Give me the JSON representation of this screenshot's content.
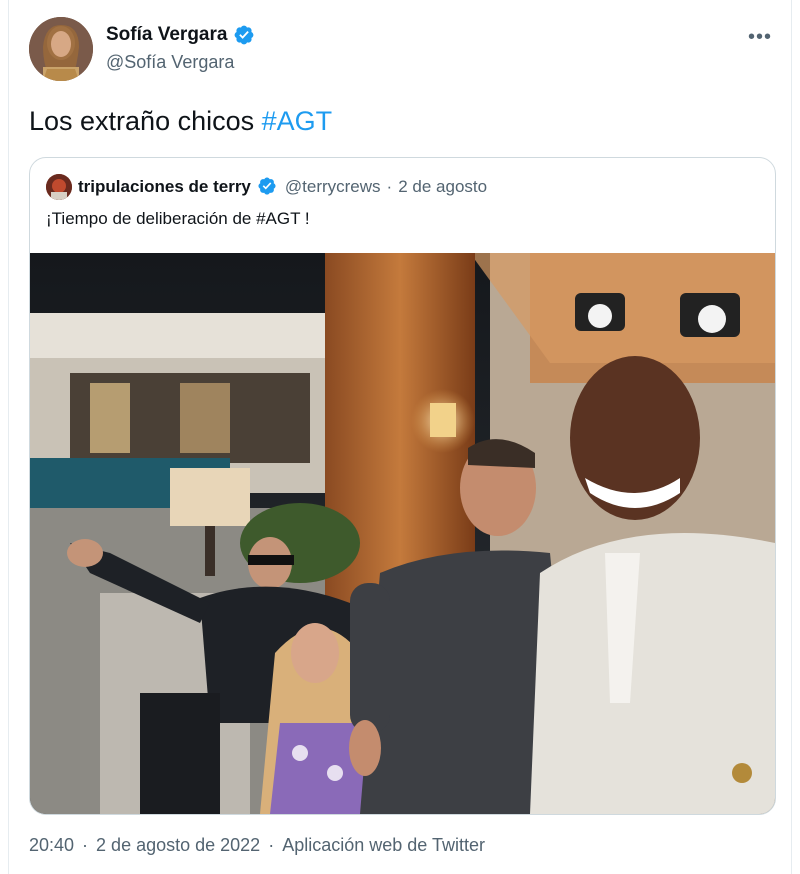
{
  "author": {
    "name": "Sofía Vergara",
    "handle": "@Sofía Vergara"
  },
  "more_label": "•••",
  "tweet": {
    "text": "Los extraño chicos ",
    "hashtag": "#AGT"
  },
  "quoted": {
    "name": "tripulaciones de terry",
    "handle": "@terrycrews",
    "separator": "·",
    "date": "2 de agosto",
    "text": "¡Tiempo de deliberación de #AGT !"
  },
  "footer": {
    "time": "20:40",
    "dot1": "·",
    "date": "2 de agosto de 2022",
    "dot2": "·",
    "source": "Aplicación web de Twitter"
  },
  "colors": {
    "accent": "#1d9bf0",
    "secondary_text": "#536471",
    "border": "#cfd9de"
  },
  "icons": [
    "verified-badge-icon",
    "more-options-icon"
  ]
}
